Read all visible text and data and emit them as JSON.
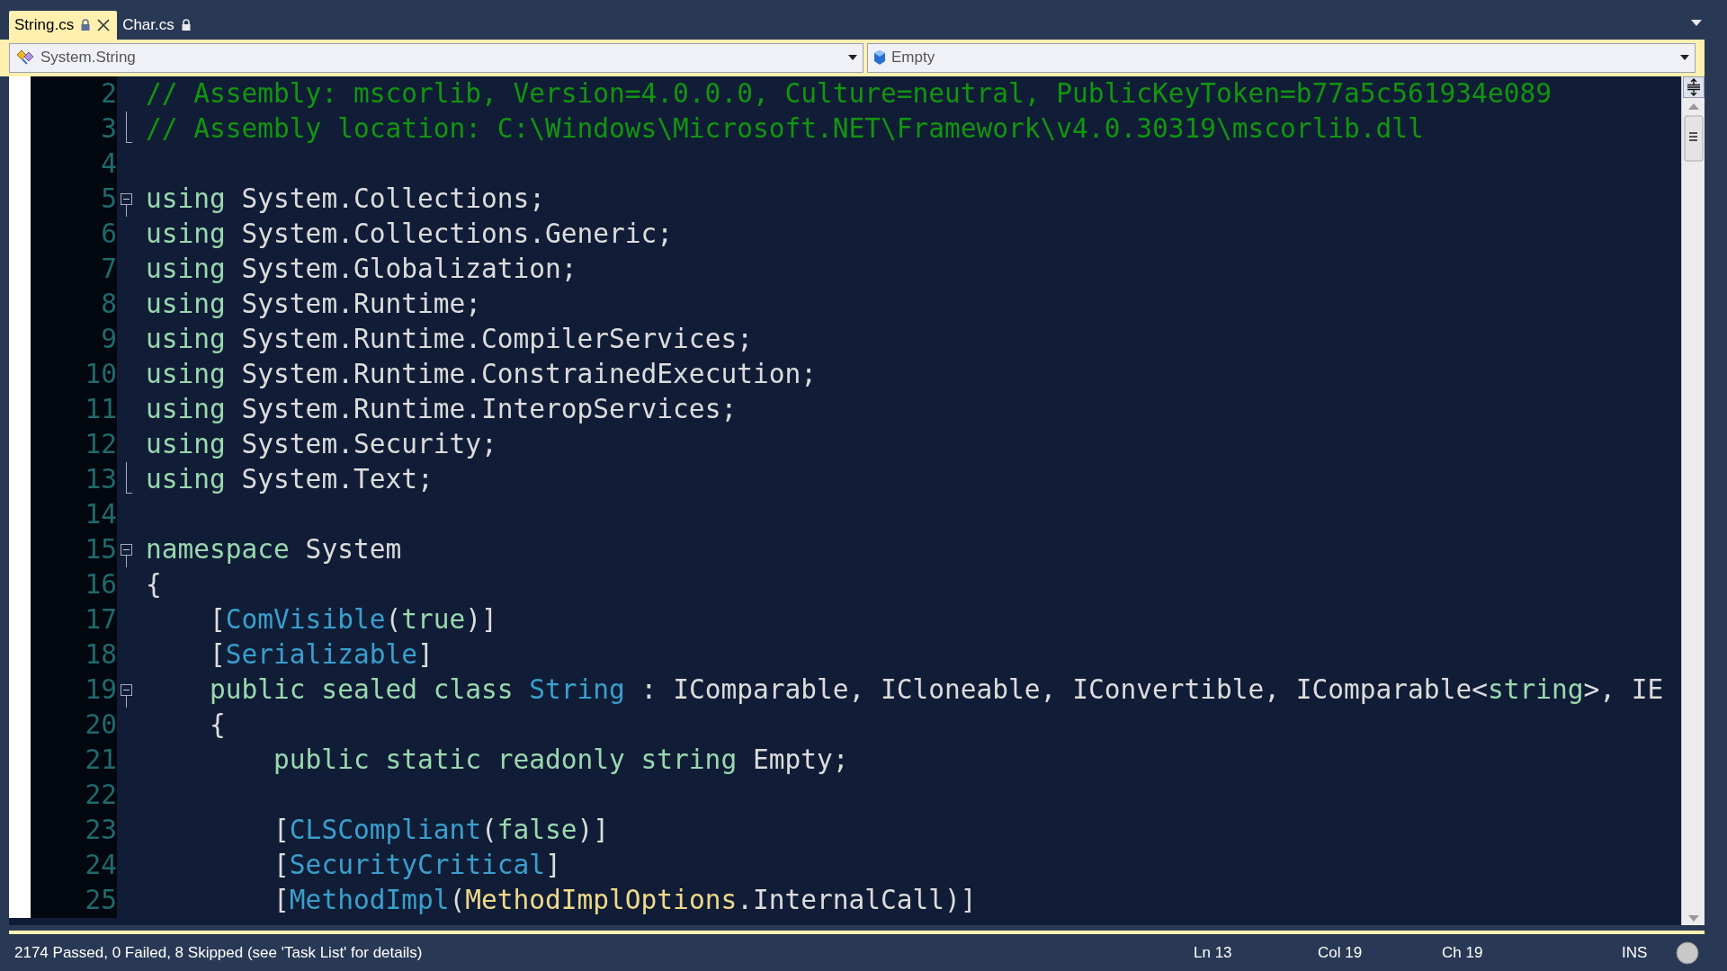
{
  "tabs": [
    {
      "label": "String.cs",
      "selected": true,
      "locked": true
    },
    {
      "label": "Char.cs",
      "selected": false,
      "locked": true
    }
  ],
  "navigation_bar": {
    "type_dropdown": "System.String",
    "member_dropdown": "Empty"
  },
  "editor": {
    "lines": [
      {
        "number": "2",
        "kind": "body",
        "tokens": [
          {
            "kind": "comment",
            "text": "// Assembly: mscorlib, Version=4.0.0.0, Culture=neutral, PublicKeyToken=b77a5c561934e089"
          }
        ]
      },
      {
        "number": "3",
        "kind": "end",
        "tokens": [
          {
            "kind": "comment",
            "text": "// Assembly location: C:\\Windows\\Microsoft.NET\\Framework\\v4.0.30319\\mscorlib.dll"
          }
        ]
      },
      {
        "number": "4",
        "kind": "blank"
      },
      {
        "number": "5",
        "kind": "start",
        "tokens": [
          {
            "kind": "keyword",
            "text": "using"
          },
          {
            "kind": "plain",
            "text": " System.Collections;"
          }
        ]
      },
      {
        "number": "6",
        "kind": "body",
        "tokens": [
          {
            "kind": "keyword",
            "text": "using"
          },
          {
            "kind": "plain",
            "text": " System.Collections.Generic;"
          }
        ]
      },
      {
        "number": "7",
        "kind": "body",
        "tokens": [
          {
            "kind": "keyword",
            "text": "using"
          },
          {
            "kind": "plain",
            "text": " System.Globalization;"
          }
        ]
      },
      {
        "number": "8",
        "kind": "body",
        "tokens": [
          {
            "kind": "keyword",
            "text": "using"
          },
          {
            "kind": "plain",
            "text": " System.Runtime;"
          }
        ]
      },
      {
        "number": "9",
        "kind": "body",
        "tokens": [
          {
            "kind": "keyword",
            "text": "using"
          },
          {
            "kind": "plain",
            "text": " System.Runtime.CompilerServices;"
          }
        ]
      },
      {
        "number": "10",
        "kind": "body",
        "tokens": [
          {
            "kind": "keyword",
            "text": "using"
          },
          {
            "kind": "plain",
            "text": " System.Runtime.ConstrainedExecution;"
          }
        ]
      },
      {
        "number": "11",
        "kind": "body",
        "tokens": [
          {
            "kind": "keyword",
            "text": "using"
          },
          {
            "kind": "plain",
            "text": " System.Runtime.InteropServices;"
          }
        ]
      },
      {
        "number": "12",
        "kind": "body",
        "tokens": [
          {
            "kind": "keyword",
            "text": "using"
          },
          {
            "kind": "plain",
            "text": " System.Security;"
          }
        ]
      },
      {
        "number": "13",
        "kind": "end",
        "tokens": [
          {
            "kind": "keyword",
            "text": "using"
          },
          {
            "kind": "plain",
            "text": " System.Text;"
          }
        ]
      },
      {
        "number": "14",
        "kind": "blank"
      },
      {
        "number": "15",
        "kind": "start",
        "tokens": [
          {
            "kind": "keyword",
            "text": "namespace"
          },
          {
            "kind": "plain",
            "text": " System"
          }
        ]
      },
      {
        "number": "16",
        "kind": "body",
        "tokens": [
          {
            "kind": "plain",
            "text": "{"
          }
        ]
      },
      {
        "number": "17",
        "kind": "body",
        "tokens": [
          {
            "kind": "plain",
            "text": "    ["
          },
          {
            "kind": "type",
            "text": "ComVisible"
          },
          {
            "kind": "plain",
            "text": "("
          },
          {
            "kind": "keyword",
            "text": "true"
          },
          {
            "kind": "plain",
            "text": ")]"
          }
        ]
      },
      {
        "number": "18",
        "kind": "body",
        "tokens": [
          {
            "kind": "plain",
            "text": "    ["
          },
          {
            "kind": "type",
            "text": "Serializable"
          },
          {
            "kind": "plain",
            "text": "]"
          }
        ]
      },
      {
        "number": "19",
        "kind": "start",
        "tokens": [
          {
            "kind": "keyword",
            "text": "    public sealed class "
          },
          {
            "kind": "type",
            "text": "String"
          },
          {
            "kind": "plain",
            "text": " : IComparable, ICloneable, IConvertible, IComparable<"
          },
          {
            "kind": "keyword",
            "text": "string"
          },
          {
            "kind": "plain",
            "text": ">, IE"
          }
        ]
      },
      {
        "number": "20",
        "kind": "body",
        "tokens": [
          {
            "kind": "plain",
            "text": "    {"
          }
        ]
      },
      {
        "number": "21",
        "kind": "body",
        "tokens": [
          {
            "kind": "keyword",
            "text": "        public static readonly string"
          },
          {
            "kind": "plain",
            "text": " Empty;"
          }
        ]
      },
      {
        "number": "22",
        "kind": "body"
      },
      {
        "number": "23",
        "kind": "body",
        "tokens": [
          {
            "kind": "plain",
            "text": "        ["
          },
          {
            "kind": "type",
            "text": "CLSCompliant"
          },
          {
            "kind": "plain",
            "text": "("
          },
          {
            "kind": "keyword",
            "text": "false"
          },
          {
            "kind": "plain",
            "text": ")]"
          }
        ]
      },
      {
        "number": "24",
        "kind": "body",
        "tokens": [
          {
            "kind": "plain",
            "text": "        ["
          },
          {
            "kind": "type",
            "text": "SecurityCritical"
          },
          {
            "kind": "plain",
            "text": "]"
          }
        ]
      },
      {
        "number": "25",
        "kind": "body",
        "tokens": [
          {
            "kind": "plain",
            "text": "        ["
          },
          {
            "kind": "type",
            "text": "MethodImpl"
          },
          {
            "kind": "plain",
            "text": "("
          },
          {
            "kind": "enum",
            "text": "MethodImplOptions"
          },
          {
            "kind": "plain",
            "text": ".InternalCall)]"
          }
        ]
      }
    ]
  },
  "status_bar": {
    "message": "2174 Passed, 0 Failed, 8 Skipped (see 'Task List' for details)",
    "line": "Ln 13",
    "column": "Col 19",
    "character": "Ch 19",
    "mode": "INS"
  }
}
